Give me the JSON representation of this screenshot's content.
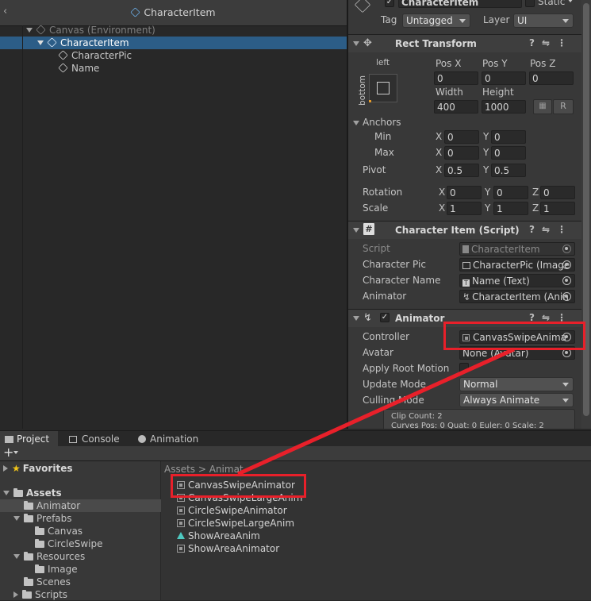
{
  "hierarchy": {
    "title": "CharacterItem",
    "items": [
      {
        "label": "Canvas (Environment)"
      },
      {
        "label": "CharacterItem"
      },
      {
        "label": "CharacterPic"
      },
      {
        "label": "Name"
      }
    ]
  },
  "inspector": {
    "object_name": "CharacterItem",
    "static_label": "Static",
    "tag_label": "Tag",
    "tag_value": "Untagged",
    "layer_label": "Layer",
    "layer_value": "UI",
    "rect_transform": {
      "title": "Rect Transform",
      "anchor_preset_h": "left",
      "anchor_preset_v": "bottom",
      "pos_x_label": "Pos X",
      "pos_y_label": "Pos Y",
      "pos_z_label": "Pos Z",
      "pos_x": "0",
      "pos_y": "0",
      "pos_z": "0",
      "width_label": "Width",
      "height_label": "Height",
      "width": "400",
      "height": "1000",
      "r_label": "R",
      "anchors_label": "Anchors",
      "min_label": "Min",
      "max_label": "Max",
      "min_x": "0",
      "min_y": "0",
      "max_x": "0",
      "max_y": "0",
      "pivot_label": "Pivot",
      "pivot_x": "0.5",
      "pivot_y": "0.5",
      "rotation_label": "Rotation",
      "rot_x": "0",
      "rot_y": "0",
      "rot_z": "0",
      "scale_label": "Scale",
      "scale_x": "1",
      "scale_y": "1",
      "scale_z": "1",
      "x": "X",
      "y": "Y",
      "z": "Z"
    },
    "character_item": {
      "title": "Character Item (Script)",
      "script_label": "Script",
      "script_value": "CharacterItem",
      "pic_label": "Character Pic",
      "pic_value": "CharacterPic (Image",
      "name_label": "Character Name",
      "name_value": "Name (Text)",
      "animator_label": "Animator",
      "animator_value": "CharacterItem (Anin"
    },
    "animator": {
      "title": "Animator",
      "controller_label": "Controller",
      "controller_value": "CanvasSwipeAnima",
      "avatar_label": "Avatar",
      "avatar_value": "None (Avatar)",
      "root_motion_label": "Apply Root Motion",
      "update_mode_label": "Update Mode",
      "update_mode_value": "Normal",
      "culling_mode_label": "Culling Mode",
      "culling_mode_value": "Always Animate",
      "info_line1": "Clip Count: 2",
      "info_line2": "Curves Pos: 0 Quat: 0 Euler: 0 Scale: 2"
    }
  },
  "tabs": [
    {
      "label": "Project"
    },
    {
      "label": "Console"
    },
    {
      "label": "Animation"
    }
  ],
  "project": {
    "add_label": "+",
    "tree": [
      {
        "label": "Favorites"
      },
      {
        "label": "Assets"
      },
      {
        "label": "Animator"
      },
      {
        "label": "Prefabs"
      },
      {
        "label": "Canvas"
      },
      {
        "label": "CircleSwipe"
      },
      {
        "label": "Resources"
      },
      {
        "label": "Image"
      },
      {
        "label": "Scenes"
      },
      {
        "label": "Scripts"
      }
    ],
    "breadcrumb": "Assets > Animat",
    "assets": [
      {
        "label": "CanvasSwipeAnimator",
        "kind": "controller"
      },
      {
        "label": "CanvasSwipeLargeAnim",
        "kind": "controller"
      },
      {
        "label": "CircleSwipeAnimator",
        "kind": "controller"
      },
      {
        "label": "CircleSwipeLargeAnim",
        "kind": "controller"
      },
      {
        "label": "ShowAreaAnim",
        "kind": "clip"
      },
      {
        "label": "ShowAreaAnimator",
        "kind": "controller"
      }
    ]
  },
  "colors": {
    "highlight": "#e8202a",
    "selection": "#2c5d87",
    "anim_clip": "#4ec9c0"
  }
}
